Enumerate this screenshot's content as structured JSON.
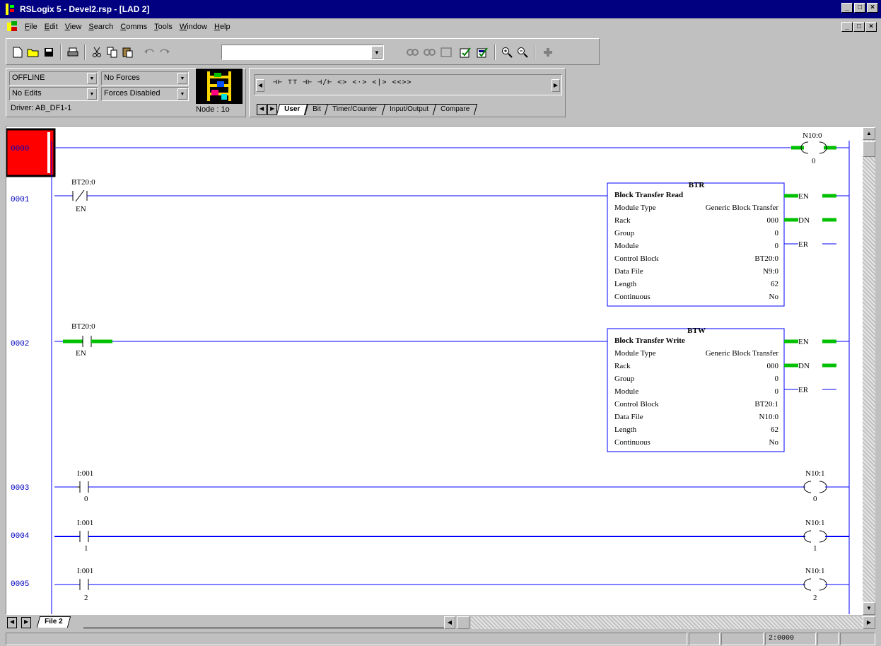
{
  "window": {
    "title": "RSLogix 5 - Devel2.rsp - [LAD 2]",
    "controls": [
      "_",
      "□",
      "×"
    ]
  },
  "menu": {
    "items": [
      {
        "key": "F",
        "rest": "ile"
      },
      {
        "key": "E",
        "rest": "dit"
      },
      {
        "key": "V",
        "rest": "iew"
      },
      {
        "key": "S",
        "rest": "earch"
      },
      {
        "key": "C",
        "rest": "omms"
      },
      {
        "key": "T",
        "rest": "ools"
      },
      {
        "key": "W",
        "rest": "indow"
      },
      {
        "key": "H",
        "rest": "elp"
      }
    ]
  },
  "toolbar": {
    "icons": [
      "new-icon",
      "open-icon",
      "save-icon",
      "print-icon",
      "cut-icon",
      "copy-icon",
      "paste-icon",
      "undo-icon",
      "redo-icon",
      "search-combo",
      "find-icon",
      "find-next-icon",
      "replace-icon",
      "verify-icon",
      "verify-file-icon",
      "zoom-in-icon",
      "zoom-out-icon",
      "add-icon"
    ],
    "search_value": ""
  },
  "status": {
    "mode": "OFFLINE",
    "forces": "No Forces",
    "edits": "No Edits",
    "forces_state": "Forces Disabled",
    "driver": "Driver: AB_DF1-1",
    "node": "Node : 1o"
  },
  "palette": {
    "glyphs": "⊣⊢ ⊤⊤ ⊣⊢ ⊣/⊢ <> <·> <|> <<>>",
    "tabs": [
      "User",
      "Bit",
      "Timer/Counter",
      "Input/Output",
      "Compare"
    ],
    "active_tab": "User"
  },
  "ladder": {
    "rungs": [
      {
        "number": "0000",
        "coil_tag": "N10:0",
        "coil_bit": "0"
      },
      {
        "number": "0001",
        "contact_tag": "BT20:0",
        "contact_bit": "EN"
      },
      {
        "number": "0002",
        "contact_tag": "BT20:0",
        "contact_bit": "EN"
      },
      {
        "number": "0003",
        "contact_tag": "I:001",
        "contact_bit": "0",
        "coil_tag": "N10:1",
        "coil_bit": "0"
      },
      {
        "number": "0004",
        "contact_tag": "I:001",
        "contact_bit": "1",
        "coil_tag": "N10:1",
        "coil_bit": "1"
      },
      {
        "number": "0005",
        "contact_tag": "I:001",
        "contact_bit": "2",
        "coil_tag": "N10:1",
        "coil_bit": "2"
      }
    ],
    "btr": {
      "mnemonic": "BTR",
      "title": "Block Transfer Read",
      "rows": [
        {
          "label": "Module Type",
          "value": "Generic Block Transfer"
        },
        {
          "label": "Rack",
          "value": "000"
        },
        {
          "label": "Group",
          "value": "0"
        },
        {
          "label": "Module",
          "value": "0"
        },
        {
          "label": "Control Block",
          "value": "BT20:0"
        },
        {
          "label": "Data File",
          "value": "N9:0"
        },
        {
          "label": "Length",
          "value": "62"
        },
        {
          "label": "Continuous",
          "value": "No"
        }
      ],
      "outputs": [
        "EN",
        "DN",
        "ER"
      ]
    },
    "btw": {
      "mnemonic": "BTW",
      "title": "Block Transfer Write",
      "rows": [
        {
          "label": "Module Type",
          "value": "Generic Block Transfer"
        },
        {
          "label": "Rack",
          "value": "000"
        },
        {
          "label": "Group",
          "value": "0"
        },
        {
          "label": "Module",
          "value": "0"
        },
        {
          "label": "Control Block",
          "value": "BT20:1"
        },
        {
          "label": "Data File",
          "value": "N10:0"
        },
        {
          "label": "Length",
          "value": "62"
        },
        {
          "label": "Continuous",
          "value": "No"
        }
      ],
      "outputs": [
        "EN",
        "DN",
        "ER"
      ]
    }
  },
  "file_tab": "File 2",
  "statusbar": {
    "position": "2:0000"
  },
  "colors": {
    "title_bar": "#000080",
    "rail": "#0000ff",
    "energized": "#00c000",
    "selected_rung": "#ff0000",
    "rung_number": "#0000c0"
  }
}
